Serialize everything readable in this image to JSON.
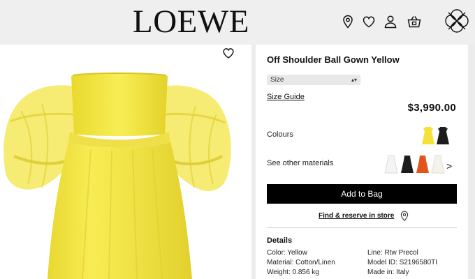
{
  "header": {
    "brand": "LOEWE",
    "icons": [
      "location-icon",
      "wishlist-icon",
      "account-icon",
      "bag-icon"
    ]
  },
  "product": {
    "title": "Off Shoulder Ball Gown Yellow",
    "size_placeholder": "Size",
    "size_guide": "Size Guide",
    "price": "$3,990.00",
    "colours_label": "Colours",
    "colours": [
      {
        "name": "yellow",
        "hex": "#f2e23a"
      },
      {
        "name": "black",
        "hex": "#1c1c1c"
      }
    ],
    "materials_label": "See other materials",
    "materials": [
      {
        "name": "white",
        "hex": "#f4f4f4"
      },
      {
        "name": "black",
        "hex": "#1c1c1c"
      },
      {
        "name": "orange",
        "hex": "#e2541c"
      },
      {
        "name": "ivory",
        "hex": "#f5f2ec"
      }
    ],
    "materials_next": ">",
    "add_to_bag": "Add to Bag",
    "find_store": "Find & reserve in store",
    "details_heading": "Details",
    "details": {
      "color": "Color: Yellow",
      "material": "Material: Cotton/Linen",
      "weight": "Weight: 0.856 kg",
      "line": "Line: Rtw Precol",
      "model_id": "Model ID: S2196580TI",
      "made_in": "Made in: Italy"
    }
  },
  "colors": {
    "accent": "#000000",
    "dress_yellow": "#f6ea3f",
    "background": "#ececec"
  }
}
